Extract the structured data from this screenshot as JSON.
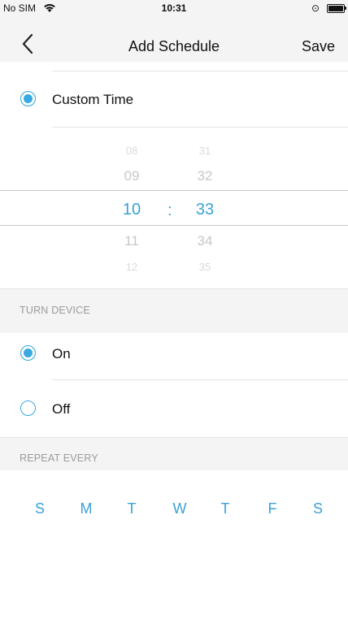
{
  "status_bar": {
    "carrier": "No SIM",
    "time": "10:31"
  },
  "nav": {
    "title": "Add Schedule",
    "save_label": "Save"
  },
  "custom_time": {
    "label": "Custom Time",
    "selected": true
  },
  "time_picker": {
    "hours": [
      "08",
      "09",
      "10",
      "11",
      "12"
    ],
    "minutes": [
      "31",
      "32",
      "33",
      "34",
      "35"
    ],
    "separator": ":",
    "selected_hour": "10",
    "selected_minute": "33"
  },
  "turn_device": {
    "header": "TURN DEVICE",
    "options": [
      {
        "label": "On",
        "selected": true
      },
      {
        "label": "Off",
        "selected": false
      }
    ]
  },
  "repeat": {
    "header": "REPEAT EVERY",
    "days": [
      "S",
      "M",
      "T",
      "W",
      "T",
      "F",
      "S"
    ]
  },
  "colors": {
    "accent": "#39a9e0",
    "nav_bg": "#f4f4f4",
    "section_text": "#9a9a9a"
  }
}
